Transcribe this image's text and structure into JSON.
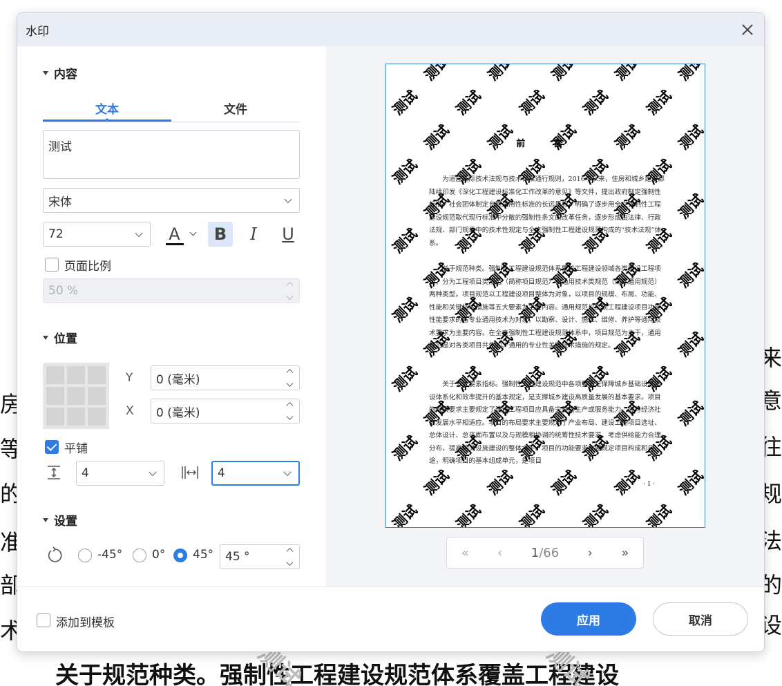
{
  "background_doc": {
    "left_chars": [
      "房",
      "等",
      "的",
      "准",
      "部",
      "术"
    ],
    "right_chars": [
      "来",
      "意",
      "往",
      "规",
      "法",
      "的",
      "设"
    ],
    "bottom_line": "关于规范种类。强制性工程建设规范体系覆盖工程建设",
    "watermark_text": "测试"
  },
  "dialog": {
    "title": "水印",
    "content_section": "内容",
    "tabs": [
      "文本",
      "文件"
    ],
    "text_value": "测试",
    "font_family": "宋体",
    "font_size": "72",
    "page_ratio_label": "页面比例",
    "page_ratio_value": "50 %",
    "position_section": "位置",
    "y_label": "Y",
    "y_value": "0 (毫米)",
    "x_label": "X",
    "x_value": "0 (毫米)",
    "tile_label": "平铺",
    "tile_vertical": "4",
    "tile_horizontal": "4",
    "settings_section": "设置",
    "rotation_options": [
      "-45°",
      "0°",
      "45°"
    ],
    "rotation_value": "45 °",
    "add_template_label": "添加到模板",
    "apply_label": "应用",
    "cancel_label": "取消"
  },
  "preview": {
    "page_title": "前 言",
    "paragraphs": [
      "为适应国际技术法规与技术标准通行规则，2016年以来，住房和城乡建设部陆续印发《深化工程建设标准化工作改革的意见》等文件，提出政府制定强制性标准、社会团体制定自愿采用性标准的长远目标，明确了逐步用全文强制性工程建设规范取代现行标准中分散的强制性条文的改革任务，逐步形成由法律、行政法规、部门规章中的技术性规定与全文强制性工程建设规范构成的“技术法规”体系。",
      "关于规范种类。强制性工程建设规范体系覆盖工程建设领域各类建设工程项目，分为工程项目类规范（简称项目规范）和通用技术类规范（简称通用规范）两种类型。项目规范以工程建设项目整体为对象，以项目的规模、布局、功能、性能和关键技术措施等五大要素为主要内容。通用规范以实现工程建设项目功能性能要求的各专业通用技术为对象，以勘察、设计、施工、维修、养护等通用技术要求为主要内容。在全文强制性工程建设规范体系中，项目规范为主干，通用规范是对各类项目共性的、通用的专业性关键技术措施的规定。",
      "关于五大要素指标。强制性工程建设规范中各项要素是保障城乡基础设施建设体系化和效率提升的基本规定，是支撑城乡建设高质量发展的基本要求。项目的规模要求主要规定了建设工程项目应具备完整的生产或服务能力，应与经济社会发展水平相适应。项目的布局要求主要规定了产业布局、建设工程项目选址、总体设计、总平面布置以及与规模相协调的统筹性技术要求，考虑供给能力合理分布，提高相关设施建设的整体水平。项目的功能要求主要规定项目构成和用途，明确项目的基本组成单元，是项目"
    ],
    "page_number": "· 1 ·",
    "current_page": "1",
    "total_pages": "/66"
  },
  "colors": {
    "accent": "#2d7be5",
    "titlebar": "#e9eef6",
    "preview_bg": "#f3f5f8"
  }
}
